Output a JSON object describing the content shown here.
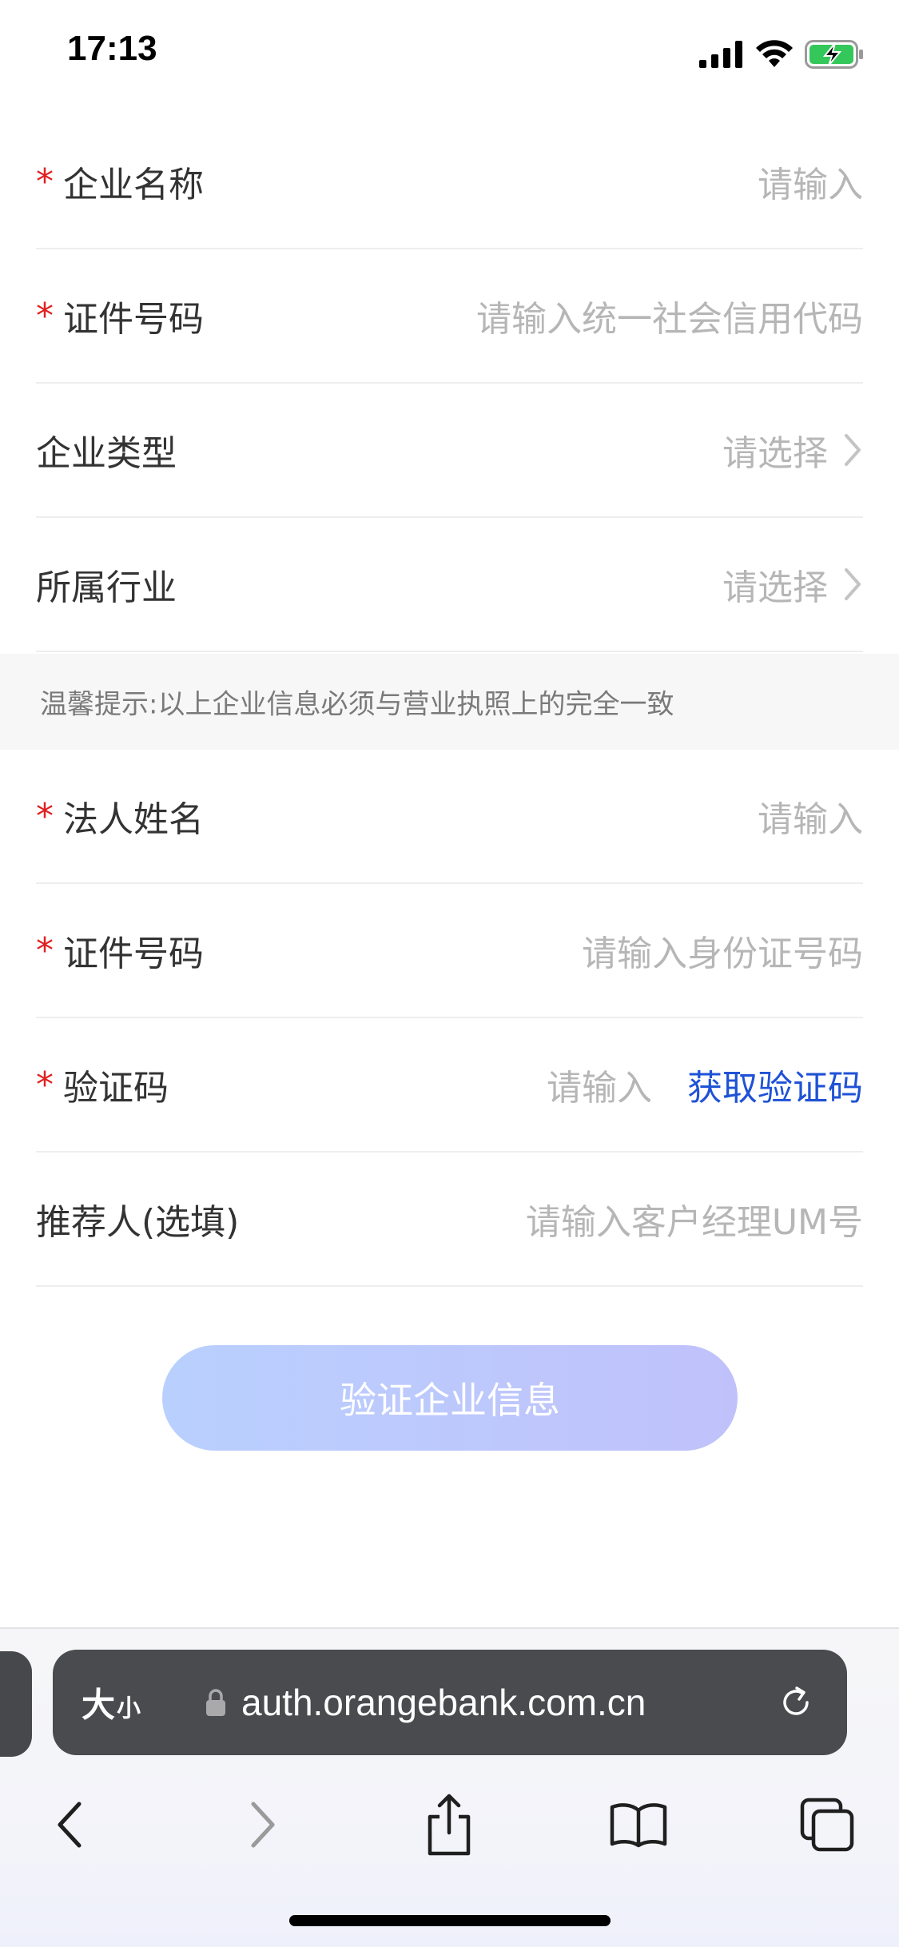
{
  "status_bar": {
    "time": "17:13"
  },
  "form": {
    "company_name": {
      "label": "企业名称",
      "placeholder": "请输入",
      "required": true
    },
    "company_id": {
      "label": "证件号码",
      "placeholder": "请输入统一社会信用代码",
      "required": true
    },
    "company_type": {
      "label": "企业类型",
      "value": "请选择",
      "required": false
    },
    "industry": {
      "label": "所属行业",
      "value": "请选择",
      "required": false
    },
    "tip": "温馨提示:以上企业信息必须与营业执照上的完全一致",
    "legal_name": {
      "label": "法人姓名",
      "placeholder": "请输入",
      "required": true
    },
    "legal_id": {
      "label": "证件号码",
      "placeholder": "请输入身份证号码",
      "required": true
    },
    "code": {
      "label": "验证码",
      "placeholder": "请输入",
      "action": "获取验证码",
      "required": true
    },
    "referrer": {
      "label": "推荐人(选填)",
      "placeholder": "请输入客户经理UM号",
      "required": false
    },
    "required_mark": "*",
    "submit": "验证企业信息"
  },
  "browser": {
    "text_size_big": "大",
    "text_size_small": "小",
    "url": "auth.orangebank.com.cn"
  },
  "colors": {
    "required": "#e02020",
    "link": "#1f52d6",
    "placeholder": "#b6b6b6",
    "button_gradient_start": "#b9d0fe",
    "button_gradient_end": "#c0c1fb"
  }
}
